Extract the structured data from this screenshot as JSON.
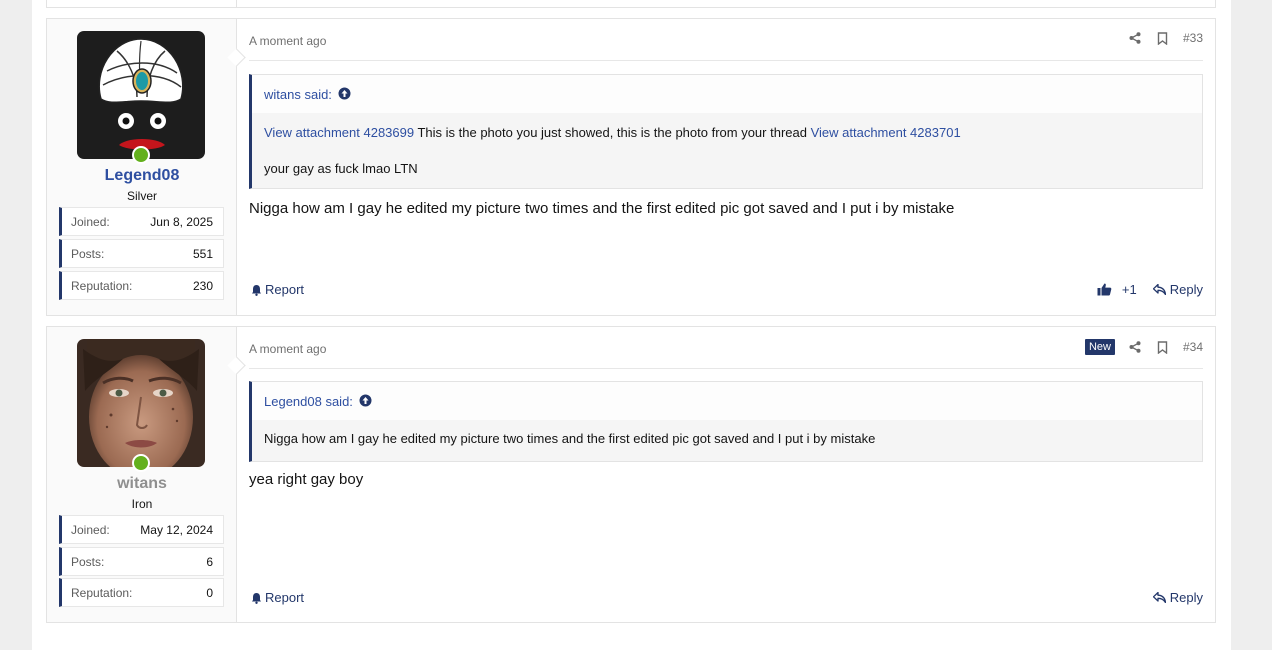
{
  "posts": [
    {
      "user": {
        "name": "Legend08",
        "title": "Silver",
        "stats": [
          {
            "label": "Joined:",
            "value": "Jun 8, 2025"
          },
          {
            "label": "Posts:",
            "value": "551"
          },
          {
            "label": "Reputation:",
            "value": "230"
          }
        ]
      },
      "time": "A moment ago",
      "number": "#33",
      "quote": {
        "author": "witans said:",
        "attachment1": "View attachment 4283699",
        "text1": " This is the photo you just showed, this is the photo from your thread ",
        "attachment2": "View attachment 4283701",
        "text2": "your gay as fuck lmao LTN"
      },
      "message": "Nigga how am I gay he edited my picture two times and the first edited pic got saved and I put i by mistake",
      "report_label": "Report",
      "reaction_count": "+1",
      "reply_label": "Reply"
    },
    {
      "user": {
        "name": "witans",
        "title": "Iron",
        "stats": [
          {
            "label": "Joined:",
            "value": "May 12, 2024"
          },
          {
            "label": "Posts:",
            "value": "6"
          },
          {
            "label": "Reputation:",
            "value": "0"
          }
        ]
      },
      "time": "A moment ago",
      "new_badge": "New",
      "number": "#34",
      "quote": {
        "author": "Legend08 said:",
        "text": "Nigga how am I gay he edited my picture two times and the first edited pic got saved and I put i by mistake"
      },
      "message": "yea right gay boy",
      "report_label": "Report",
      "reply_label": "Reply"
    }
  ],
  "colors": {
    "accent": "#23376a",
    "link": "#2e4fa1",
    "online": "#63b01d",
    "muted": "#707070"
  }
}
